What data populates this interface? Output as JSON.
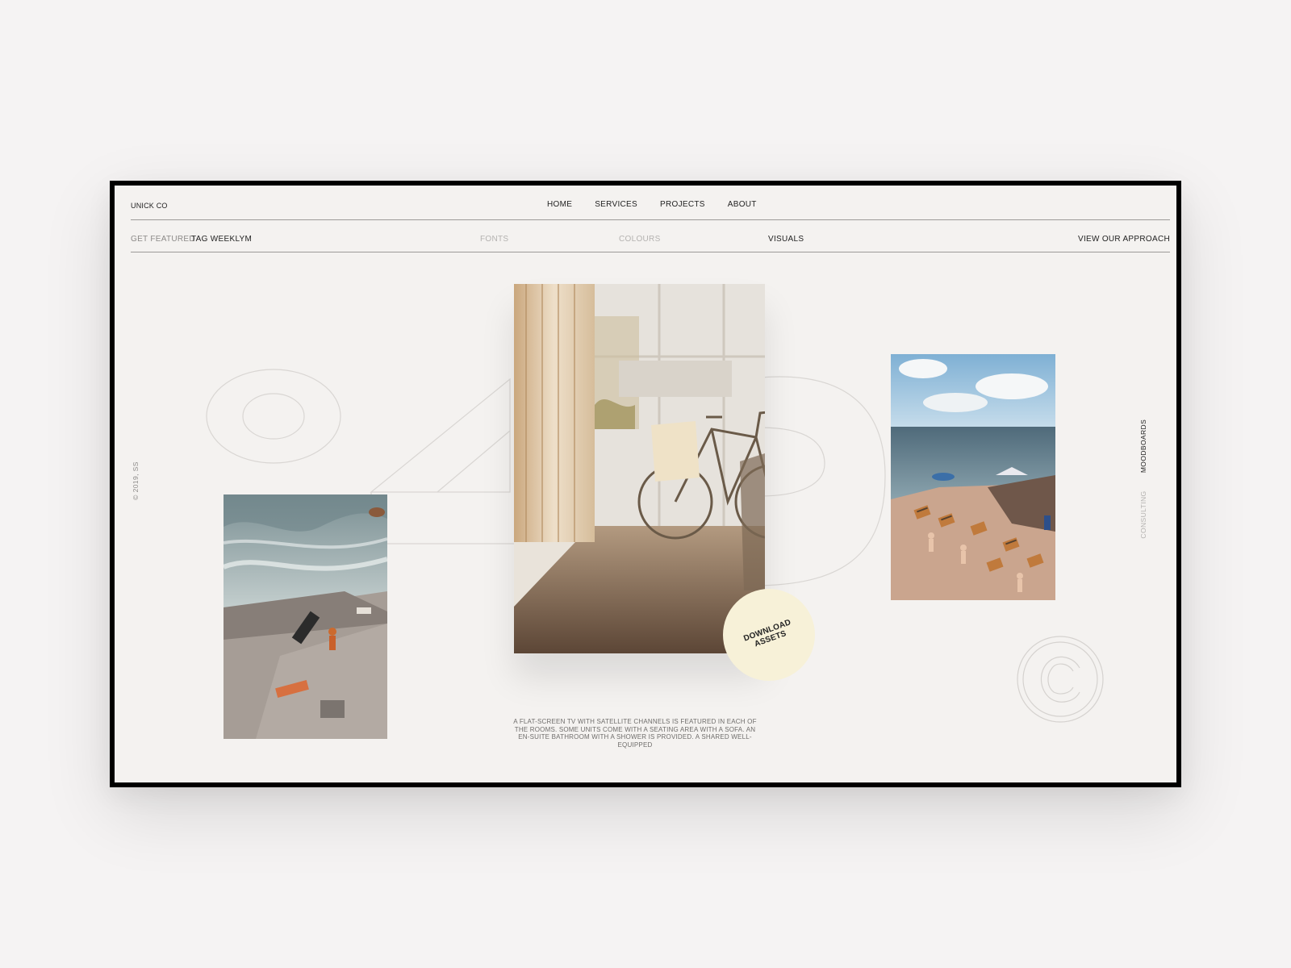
{
  "brand": "UNICK CO",
  "nav": [
    "HOME",
    "SERVICES",
    "PROJECTS",
    "ABOUT"
  ],
  "subbar": {
    "get_featured": "GET FEATURED",
    "tag": "TAG WEEKLYM",
    "fonts": "FONTS",
    "colours": "COLOURS",
    "visuals": "VISUALS",
    "view_approach": "VIEW OUR APPROACH"
  },
  "copyright": "© 2019, SS",
  "side_menu": {
    "moodboards": "MOODBOARDS",
    "consulting": "CONSULTING"
  },
  "big_number": "049",
  "download": "DOWNLOAD ASSETS",
  "caption": "A FLAT-SCREEN TV WITH SATELLITE CHANNELS IS FEATURED IN EACH OF THE ROOMS. SOME UNITS COME WITH A SEATING AREA WITH A SOFA. AN EN-SUITE BATHROOM WITH A SHOWER IS PROVIDED. A SHARED WELL-EQUIPPED",
  "images": {
    "left": "sea pool",
    "center": "bicycle by window",
    "right": "beach with deck chairs"
  },
  "colors": {
    "background": "#f4f2f0",
    "frame": "#000000",
    "accent_circle": "#f7f1d8",
    "text": "#222222",
    "muted": "#8c8a88"
  }
}
